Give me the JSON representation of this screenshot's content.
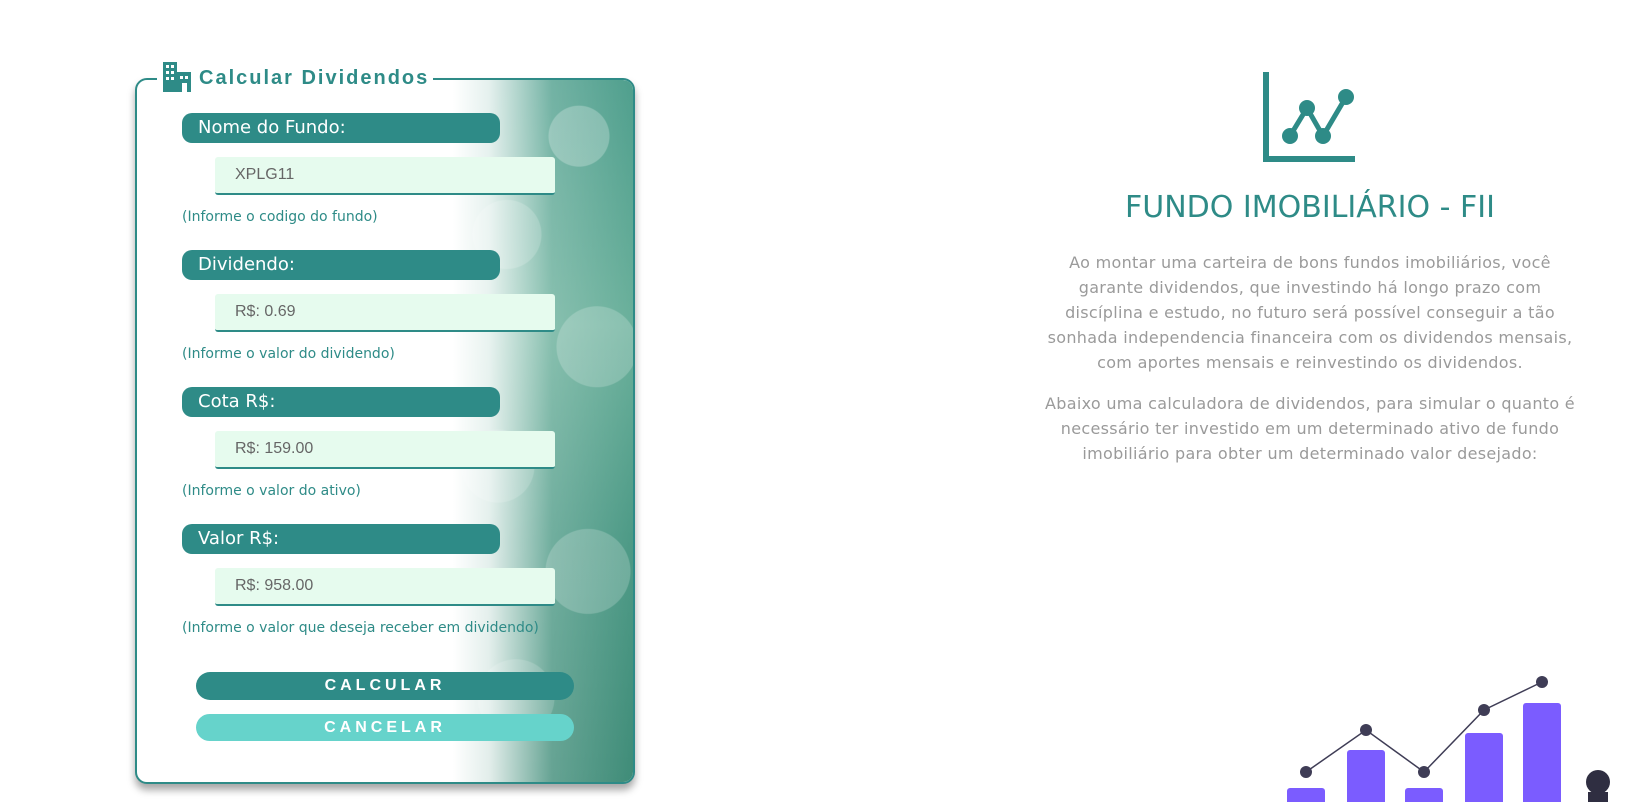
{
  "form": {
    "legend_title": "Calcular Dividendos",
    "legend_icon": "building-icon",
    "fields": [
      {
        "label": "Nome do Fundo:",
        "value": "XPLG11",
        "hint": "(Informe o codigo do fundo)"
      },
      {
        "label": "Dividendo:",
        "value": "R$: 0.69",
        "hint": "(Informe o valor do dividendo)"
      },
      {
        "label": "Cota R$:",
        "value": "R$: 159.00",
        "hint": "(Informe o valor do ativo)"
      },
      {
        "label": "Valor R$:",
        "value": "R$: 958.00",
        "hint": "(Informe o valor que deseja receber em dividendo)"
      }
    ],
    "calcular_label": "CALCULAR",
    "cancelar_label": "CANCELAR"
  },
  "info": {
    "icon": "line-chart-icon",
    "title": "FUNDO IMOBILIÁRIO - FII",
    "paragraph_1": "Ao montar uma carteira de bons fundos imobiliários, você garante dividendos, que investindo há longo prazo com discíplina e estudo, no futuro será possível conseguir a tão sonhada independencia financeira com os dividendos mensais, com aportes mensais e reinvestindo os dividendos.",
    "paragraph_2": "Abaixo uma calculadora de dividendos, para simular o quanto é necessário ter investido em um determinado ativo de fundo imobiliário para obter um determinado valor desejado:"
  },
  "colors": {
    "primary": "#2e8b87",
    "secondary": "#66d3cb",
    "input_bg": "#e6fbee",
    "text_muted": "#9a9a9a",
    "bar_purple": "#7b5cff"
  }
}
